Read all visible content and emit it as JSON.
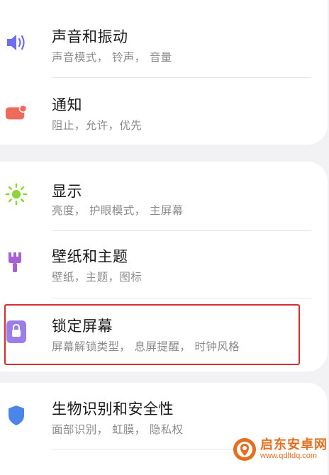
{
  "settings": [
    {
      "title": "声音和振动",
      "subtitle": "声音模式， 铃声， 音量",
      "icon": "speaker-icon",
      "color": "#6b6ef0"
    },
    {
      "title": "通知",
      "subtitle": "阻止，允许，优先",
      "icon": "notification-icon",
      "color": "#ef6a5a"
    },
    {
      "title": "显示",
      "subtitle": "亮度， 护眼模式， 主屏幕",
      "icon": "sun-icon",
      "color": "#8bd43a"
    },
    {
      "title": "壁纸和主题",
      "subtitle": "壁纸，主题，图标",
      "icon": "brush-icon",
      "color": "#a65fd6"
    },
    {
      "title": "锁定屏幕",
      "subtitle": "屏幕解锁类型， 息屏提醒， 时钟风格",
      "icon": "lock-icon",
      "color": "#9b7ee8"
    },
    {
      "title": "生物识别和安全性",
      "subtitle": "面部识别， 虹膜， 隐私权",
      "icon": "shield-icon",
      "color": "#4a86e8"
    }
  ],
  "watermark": {
    "title": "启东安卓网",
    "url": "www.qdltdq.com",
    "color": "#e56f1f"
  }
}
